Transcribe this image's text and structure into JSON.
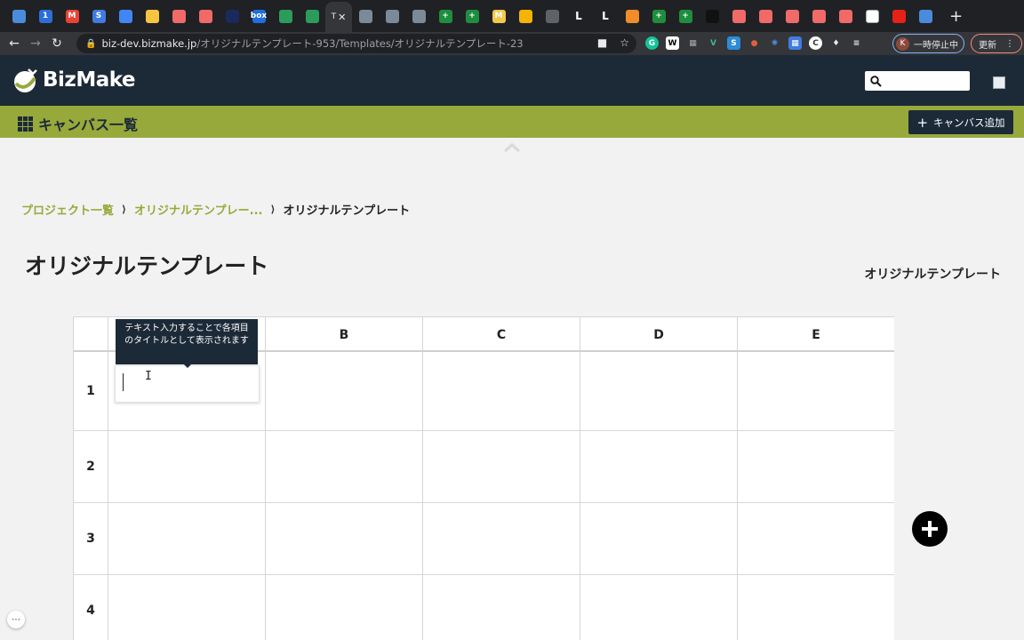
{
  "browser": {
    "url_host": "biz-dev.bizmake.jp",
    "url_path": "/オリジナルテンプレート-953/Templates/オリジナルテンプレート-23",
    "active_tab_title": "T",
    "profile_initial": "K",
    "profile_status": "一時停止中",
    "update_label": "更新",
    "tabs": [
      {
        "icon": "docs-icon",
        "color": "#4a8cdb",
        "glyph": ""
      },
      {
        "icon": "onepassword-icon",
        "color": "#2b6fd6",
        "glyph": "1"
      },
      {
        "icon": "gmail-icon",
        "color": "#ea4335",
        "glyph": "M"
      },
      {
        "icon": "sites-icon",
        "color": "#3f7be0",
        "glyph": "S"
      },
      {
        "icon": "docs-icon",
        "color": "#4285f4",
        "glyph": ""
      },
      {
        "icon": "notes-icon",
        "color": "#f5c542",
        "glyph": ""
      },
      {
        "icon": "asana-icon",
        "color": "#f06a6a",
        "glyph": ""
      },
      {
        "icon": "asana-icon",
        "color": "#f06a6a",
        "glyph": ""
      },
      {
        "icon": "circle-icon",
        "color": "#1b2a5c",
        "glyph": ""
      },
      {
        "icon": "box-icon",
        "color": "#1f6fe0",
        "glyph": "box"
      },
      {
        "icon": "sheet-m-icon",
        "color": "#2c9c5a",
        "glyph": ""
      },
      {
        "icon": "sheet-m-icon",
        "color": "#2c9c5a",
        "glyph": ""
      }
    ],
    "tabs_after": [
      {
        "icon": "bird-icon",
        "color": "#7a8a99",
        "glyph": ""
      },
      {
        "icon": "bird-icon",
        "color": "#7a8a99",
        "glyph": ""
      },
      {
        "icon": "bird-icon",
        "color": "#7a8a99",
        "glyph": ""
      },
      {
        "icon": "plus-sheet-icon",
        "color": "#1e8e3e",
        "glyph": "+"
      },
      {
        "icon": "plus-sheet-icon",
        "color": "#1e8e3e",
        "glyph": "+"
      },
      {
        "icon": "miro-icon",
        "color": "#f2c94c",
        "glyph": "M"
      },
      {
        "icon": "slides-icon",
        "color": "#f4b400",
        "glyph": ""
      },
      {
        "icon": "globe-icon",
        "color": "#5f6368",
        "glyph": ""
      },
      {
        "icon": "l-icon",
        "color": "#000000",
        "glyph": "L"
      },
      {
        "icon": "l-icon",
        "color": "#000000",
        "glyph": "L"
      },
      {
        "icon": "cube-icon",
        "color": "#f08c2a",
        "glyph": ""
      },
      {
        "icon": "plus-sheet-icon",
        "color": "#1e8e3e",
        "glyph": "+"
      },
      {
        "icon": "plus-sheet-icon",
        "color": "#1e8e3e",
        "glyph": "+"
      },
      {
        "icon": "drop-icon",
        "color": "#111111",
        "glyph": ""
      },
      {
        "icon": "asana-icon",
        "color": "#f06a6a",
        "glyph": ""
      },
      {
        "icon": "asana-icon",
        "color": "#f06a6a",
        "glyph": ""
      },
      {
        "icon": "asana-icon",
        "color": "#f06a6a",
        "glyph": ""
      },
      {
        "icon": "asana-icon",
        "color": "#f06a6a",
        "glyph": ""
      },
      {
        "icon": "asana-icon",
        "color": "#f06a6a",
        "glyph": ""
      },
      {
        "icon": "calendar-icon",
        "color": "#ffffff",
        "glyph": ""
      },
      {
        "icon": "youtube-icon",
        "color": "#e62117",
        "glyph": ""
      },
      {
        "icon": "settings-icon",
        "color": "#4a8cdb",
        "glyph": ""
      }
    ]
  },
  "app": {
    "logo_prefix": "Biz",
    "logo_suffix": "Make",
    "nav_label": "キャンバス一覧",
    "add_canvas_label": "キャンバス追加"
  },
  "breadcrumb": {
    "project_list": "プロジェクト一覧",
    "parent": "オリジナルテンプレー...",
    "current": "オリジナルテンプレート"
  },
  "page": {
    "title": "オリジナルテンプレート",
    "side_title": "オリジナルテンプレート"
  },
  "grid": {
    "columns": [
      "",
      "B",
      "C",
      "D",
      "E"
    ],
    "rows": [
      "1",
      "2",
      "3",
      "4"
    ]
  },
  "tooltip": {
    "text": "テキスト入力することで各項目のタイトルとして表示されます"
  },
  "colors": {
    "header_bg": "#1c2a38",
    "accent_green": "#97a93b",
    "page_bg": "#f2f2f2"
  }
}
